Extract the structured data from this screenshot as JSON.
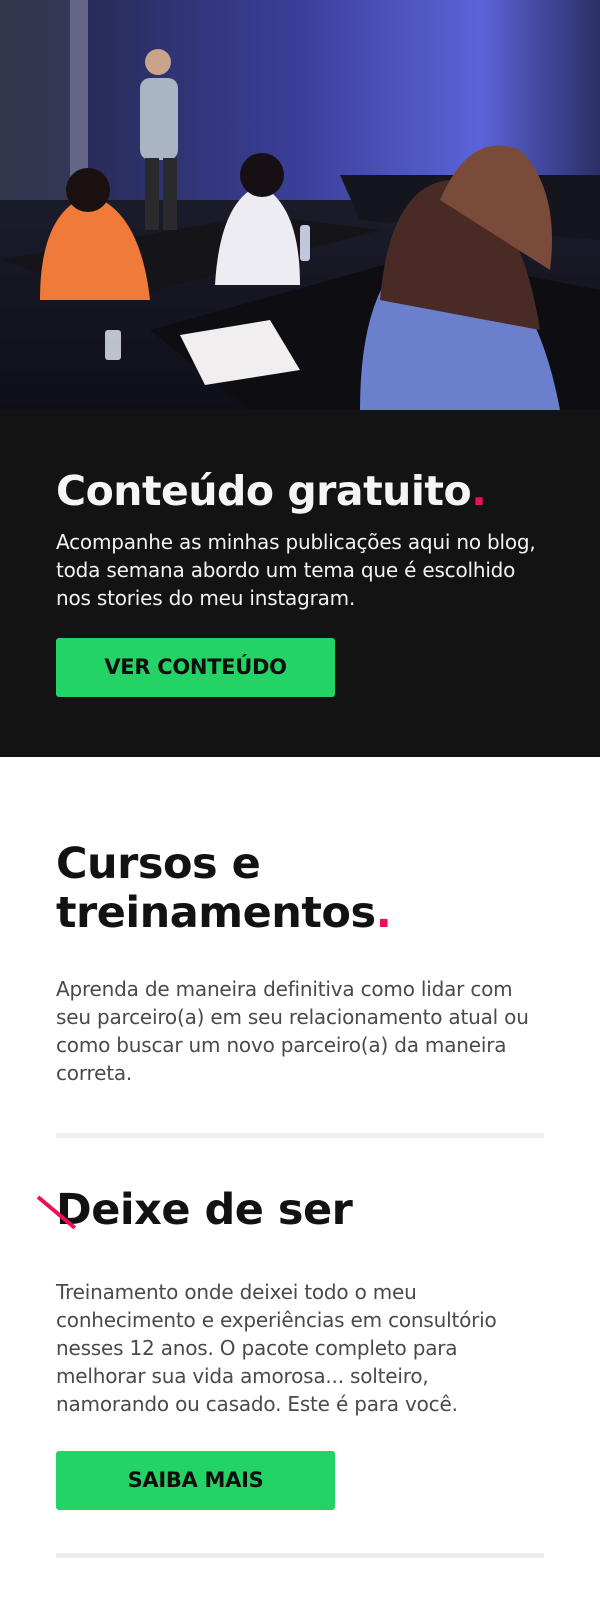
{
  "hero": {
    "image_alt": "speaker-presenting-to-audience-photo"
  },
  "free_content": {
    "title": "Conteúdo gratuito",
    "title_dot": ".",
    "description": "Acompanhe as minhas publicações aqui no blog, toda semana abordo um tema que é escolhido nos stories do meu instagram.",
    "button_label": "VER CONTEÚDO"
  },
  "courses": {
    "title_line1": "Cursos e",
    "title_line2": "treinamentos",
    "title_dot": ".",
    "description": "Aprenda de maneira definitiva como lidar com seu parceiro(a) em seu relacionamento atual ou como buscar um novo parceiro(a) da maneira correta."
  },
  "course_item": {
    "title": "Deixe de ser",
    "description": "Treinamento onde deixei todo o meu conhecimento e experiências em consultório nesses 12 anos. O pacote completo para melhorar sua vida amorosa... solteiro, namorando ou casado. Este é para você.",
    "button_label": "SAIBA MAIS"
  },
  "colors": {
    "accent_dot": "#ec1152",
    "button_green": "#24d366",
    "dark_bg": "#131313"
  }
}
